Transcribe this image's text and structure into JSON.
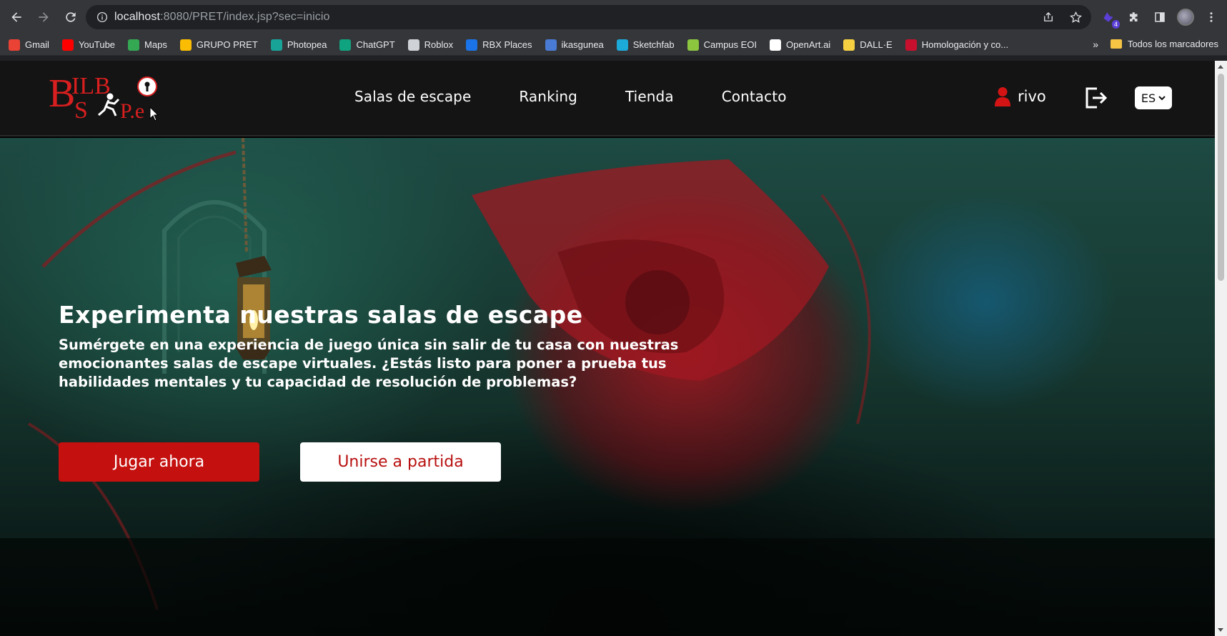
{
  "browser": {
    "url_host": "localhost",
    "url_rest": ":8080/PRET/index.jsp?sec=inicio",
    "extension_badge": "4",
    "bookmarks": [
      {
        "label": "Gmail",
        "color": "#ea4335"
      },
      {
        "label": "YouTube",
        "color": "#ff0000"
      },
      {
        "label": "Maps",
        "color": "#34a853"
      },
      {
        "label": "GRUPO PRET",
        "color": "#fbbc04"
      },
      {
        "label": "Photopea",
        "color": "#18a497"
      },
      {
        "label": "ChatGPT",
        "color": "#10a37f"
      },
      {
        "label": "Roblox",
        "color": "#cfd2d6"
      },
      {
        "label": "RBX Places",
        "color": "#1a73e8"
      },
      {
        "label": "ikasgunea",
        "color": "#4a7bd4"
      },
      {
        "label": "Sketchfab",
        "color": "#1caad9"
      },
      {
        "label": "Campus EOI",
        "color": "#8cc63f"
      },
      {
        "label": "OpenArt.ai",
        "color": "#ffffff"
      },
      {
        "label": "DALL·E",
        "color": "#f5d142"
      },
      {
        "label": "Homologación y co...",
        "color": "#c8102e"
      }
    ],
    "more_label": "»",
    "all_bookmarks_label": "Todos los marcadores"
  },
  "site": {
    "nav": [
      "Salas de escape",
      "Ranking",
      "Tienda",
      "Contacto"
    ],
    "user": "rivo",
    "language": "ES"
  },
  "hero": {
    "title": "Experimenta nuestras salas de escape",
    "text": "Sumérgete en una experiencia de juego única sin salir de tu casa con nuestras emocionantes salas de escape virtuales. ¿Estás listo para poner a prueba tus habilidades mentales y tu capacidad de resolución de problemas?",
    "primary_button": "Jugar ahora",
    "secondary_button": "Unirse a partida"
  },
  "colors": {
    "brand_red": "#c4100f",
    "header_bg": "#141414"
  }
}
